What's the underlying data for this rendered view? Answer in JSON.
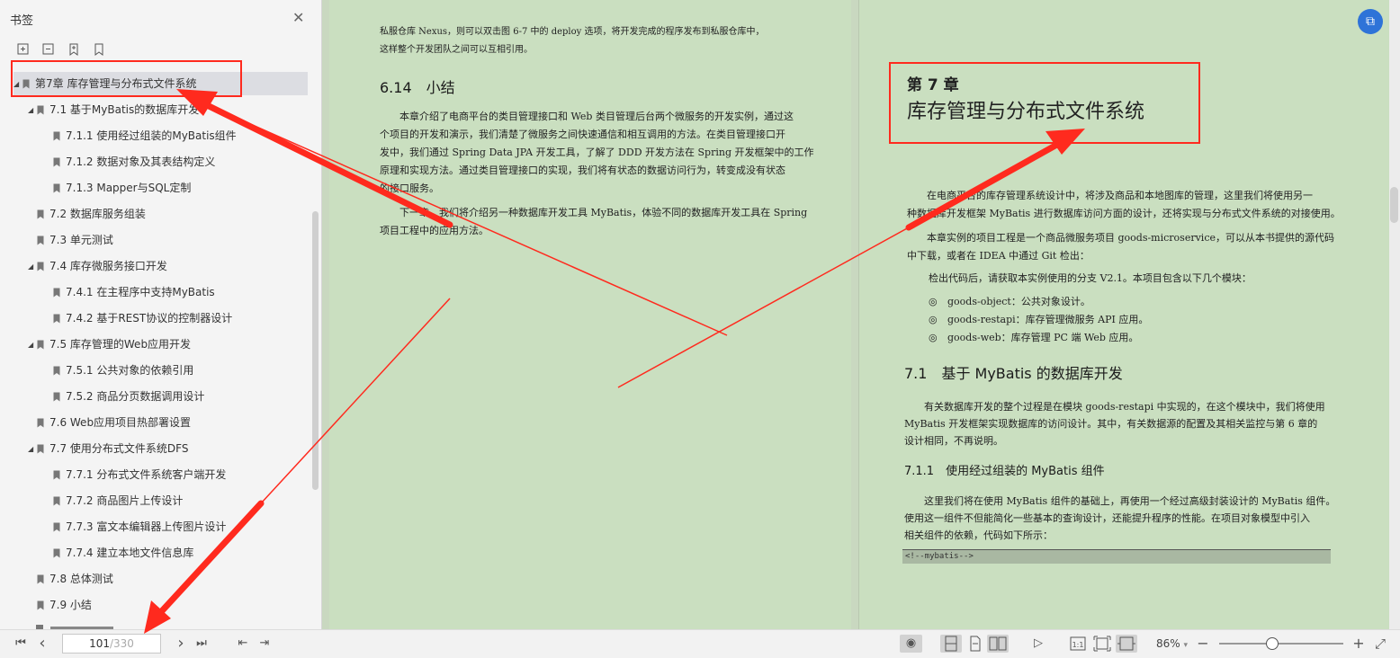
{
  "sidebar": {
    "title": "书签",
    "tools": [
      {
        "name": "expand-all-icon"
      },
      {
        "name": "collapse-all-icon"
      },
      {
        "name": "add-bookmark-icon"
      },
      {
        "name": "bookmark-icon"
      }
    ],
    "items": [
      {
        "label": "第7章 库存管理与分布式文件系统",
        "level": 0,
        "arrow": "down",
        "selected": true
      },
      {
        "label": "7.1 基于MyBatis的数据库开发",
        "level": 1,
        "arrow": "down"
      },
      {
        "label": "7.1.1 使用经过组装的MyBatis组件",
        "level": 2
      },
      {
        "label": "7.1.2 数据对象及其表结构定义",
        "level": 2
      },
      {
        "label": "7.1.3 Mapper与SQL定制",
        "level": 2
      },
      {
        "label": "7.2 数据库服务组装",
        "level": 1
      },
      {
        "label": "7.3 单元测试",
        "level": 1
      },
      {
        "label": "7.4 库存微服务接口开发",
        "level": 1,
        "arrow": "down"
      },
      {
        "label": "7.4.1 在主程序中支持MyBatis",
        "level": 2
      },
      {
        "label": "7.4.2 基于REST协议的控制器设计",
        "level": 2
      },
      {
        "label": "7.5 库存管理的Web应用开发",
        "level": 1,
        "arrow": "down"
      },
      {
        "label": "7.5.1 公共对象的依赖引用",
        "level": 2
      },
      {
        "label": "7.5.2 商品分页数据调用设计",
        "level": 2
      },
      {
        "label": "7.6 Web应用项目热部署设置",
        "level": 1
      },
      {
        "label": "7.7 使用分布式文件系统DFS",
        "level": 1,
        "arrow": "down"
      },
      {
        "label": "7.7.1 分布式文件系统客户端开发",
        "level": 2
      },
      {
        "label": "7.7.2 商品图片上传设计",
        "level": 2
      },
      {
        "label": "7.7.3 富文本编辑器上传图片设计",
        "level": 2
      },
      {
        "label": "7.7.4 建立本地文件信息库",
        "level": 2
      },
      {
        "label": "7.8 总体测试",
        "level": 1
      },
      {
        "label": "7.9 小结",
        "level": 1
      }
    ]
  },
  "page_left": {
    "intro_line1": "私服仓库 Nexus，则可以双击图 6-7 中的 deploy 选项，将开发完成的程序发布到私服仓库中，",
    "intro_line2": "这样整个开发团队之间可以互相引用。",
    "section_title": "6.14　小结",
    "para1": [
      "本章介绍了电商平台的类目管理接口和 Web 类目管理后台两个微服务的开发实例，通过这",
      "个项目的开发和演示，我们清楚了微服务之间快速通信和相互调用的方法。在类目管理接口开",
      "发中，我们通过 Spring Data JPA 开发工具，了解了 DDD 开发方法在 Spring 开发框架中的工作",
      "原理和实现方法。通过类目管理接口的实现，我们将有状态的数据访问行为，转变成没有状态",
      "的接口服务。"
    ],
    "para2": [
      "下一章，我们将介绍另一种数据库开发工具 MyBatis，体验不同的数据库开发工具在 Spring",
      "项目工程中的应用方法。"
    ]
  },
  "page_right": {
    "chapter_number": "第 7 章",
    "chapter_title": "库存管理与分布式文件系统",
    "para1": [
      "在电商平台的库存管理系统设计中，将涉及商品和本地图库的管理，这里我们将使用另一",
      "种数据库开发框架 MyBatis 进行数据库访问方面的设计，还将实现与分布式文件系统的对接使用。"
    ],
    "para2": [
      "本章实例的项目工程是一个商品微服务项目 goods-microservice，可以从本书提供的源代码",
      "中下载，或者在 IDEA 中通过 Git 检出："
    ],
    "para3": "检出代码后，请获取本实例使用的分支 V2.1。本项目包含以下几个模块：",
    "bullets": [
      "goods-object：公共对象设计。",
      "goods-restapi：库存管理微服务 API 应用。",
      "goods-web：库存管理 PC 端 Web 应用。"
    ],
    "bullet_glyph": "◎",
    "section_title": "7.1　基于 MyBatis 的数据库开发",
    "para4": [
      "有关数据库开发的整个过程是在模块 goods-restapi 中实现的，在这个模块中，我们将使用",
      "MyBatis 开发框架实现数据库的访问设计。其中，有关数据源的配置及其相关监控与第 6 章的",
      "设计相同，不再说明。"
    ],
    "subsection_title": "7.1.1　使用经过组装的 MyBatis 组件",
    "para5": [
      "这里我们将在使用 MyBatis 组件的基础上，再使用一个经过高级封装设计的 MyBatis 组件。",
      "使用这一组件不但能简化一些基本的查询设计，还能提升程序的性能。在项目对象模型中引入",
      "相关组件的依赖，代码如下所示："
    ],
    "code": "<!--mybatis-->"
  },
  "toolbar": {
    "page_current": "101",
    "page_total": "/330",
    "zoom_label": "86%",
    "zoom_caret": "▾",
    "zoom_fraction": 0.42,
    "glyphs": {
      "first": "⏮",
      "prev": "‹",
      "next": "›",
      "last": "⏭",
      "back": "⇤",
      "forward": "⇥",
      "eye": "◉",
      "play": "▷",
      "minus": "−",
      "plus": "+",
      "fullscreen": "⤢"
    }
  },
  "colors": {
    "annotation_red": "#ff2a1e",
    "page_bg": "#cadfc0",
    "fab_blue": "#2e73d8"
  }
}
